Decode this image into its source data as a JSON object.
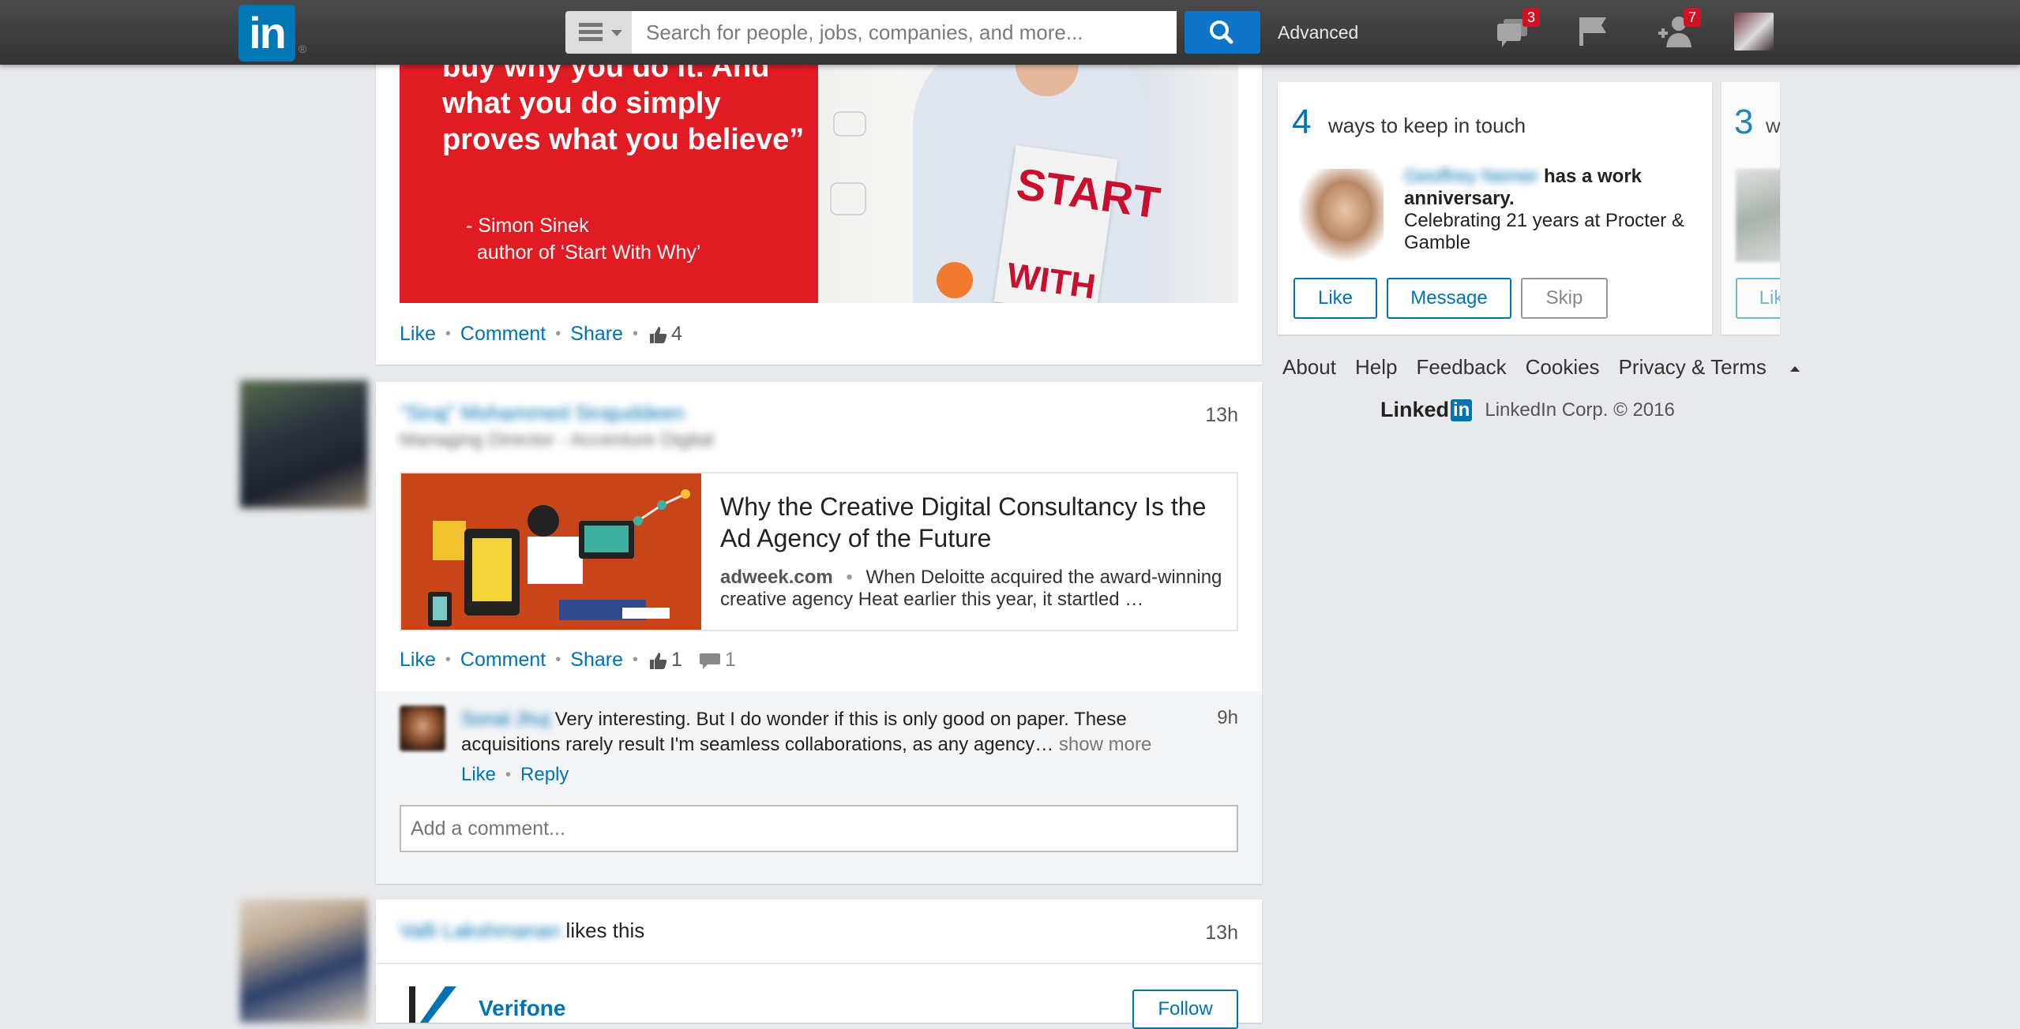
{
  "header": {
    "logo_text": "in",
    "logo_reg": "®",
    "search_placeholder": "Search for people, jobs, companies, and more...",
    "advanced_label": "Advanced",
    "messages_badge": "3",
    "connections_badge": "7",
    "accent_color": "#0077b5"
  },
  "post1": {
    "quote": "buy why you do it. And what you do simply proves what you believe”",
    "author_line1": "- Simon Sinek",
    "author_line2": "author of ‘Start With Why’",
    "book_title_1": "START",
    "book_title_2": "WITH",
    "actions": {
      "like": "Like",
      "comment": "Comment",
      "share": "Share",
      "like_count": "4"
    }
  },
  "post2": {
    "author_name": "\"Siraj\" Mohammed Sirajuddeen",
    "author_headline": "Managing Director - Accenture Digital",
    "time": "13h",
    "article_title": "Why the Creative Digital Consultancy Is the Ad Agency of the Future",
    "article_source": "adweek.com",
    "article_snippet": "When Deloitte acquired the award-winning creative agency Heat earlier this year, it startled …",
    "actions": {
      "like": "Like",
      "comment": "Comment",
      "share": "Share",
      "like_count": "1",
      "comment_count": "1"
    },
    "comment": {
      "author": "Sonal Jhuj",
      "text": "Very interesting. But I do wonder if this is only good on paper. These acquisitions rarely result I'm seamless collaborations, as any agency…",
      "show_more": "show more",
      "time": "9h",
      "like": "Like",
      "reply": "Reply"
    },
    "add_comment_placeholder": "Add a comment..."
  },
  "post3": {
    "actor_name": "Valli Lakshmanan",
    "likes_this": "likes this",
    "time": "13h",
    "company_name": "Verifone",
    "follow_label": "Follow"
  },
  "sidebar": {
    "keep_in_touch_count": "4",
    "keep_in_touch_label": "ways to keep in touch",
    "contact_name": "Geoffrey Nemer",
    "anniversary_text": "has a work anniversary.",
    "anniversary_detail": "Celebrating 21 years at Procter & Gamble",
    "like_btn": "Like",
    "message_btn": "Message",
    "skip_btn": "Skip",
    "next_card_count": "3",
    "next_card_letter": "w",
    "next_card_btn": "Lik"
  },
  "footer": {
    "links": [
      "About",
      "Help",
      "Feedback",
      "Cookies",
      "Privacy & Terms"
    ],
    "brand": "Linked",
    "brand_in": "in",
    "copyright": "LinkedIn Corp. © 2016"
  }
}
